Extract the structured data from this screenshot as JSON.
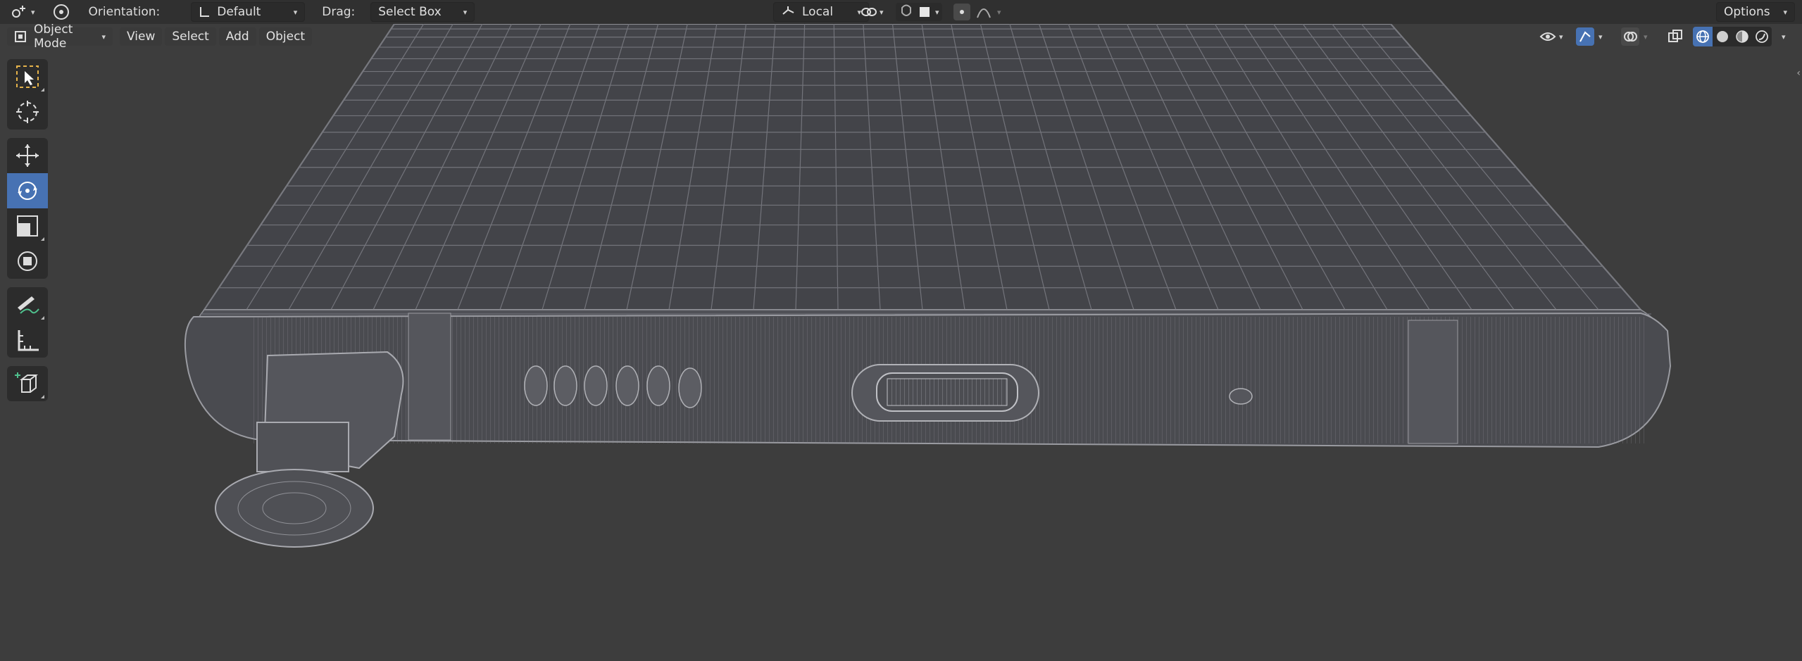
{
  "header": {
    "orientation_label": "Orientation:",
    "orientation_value": "Default",
    "drag_label": "Drag:",
    "drag_value": "Select Box",
    "pivot_value": "Local",
    "options_label": "Options"
  },
  "row2": {
    "mode": "Object Mode",
    "menus": [
      "View",
      "Select",
      "Add",
      "Object"
    ]
  },
  "toolbar": {
    "groups": [
      [
        "select-box-tool",
        "cursor-tool"
      ],
      [
        "move-tool",
        "rotate-tool",
        "scale-tool",
        "transform-tool"
      ],
      [
        "annotate-tool",
        "measure-tool"
      ],
      [
        "add-cube-tool"
      ]
    ],
    "active": "rotate-tool"
  },
  "colors": {
    "viewport_bg": "#3d3d3d",
    "header_bg": "#303030",
    "accent": "#4772b3",
    "wire": "#8f9096"
  }
}
